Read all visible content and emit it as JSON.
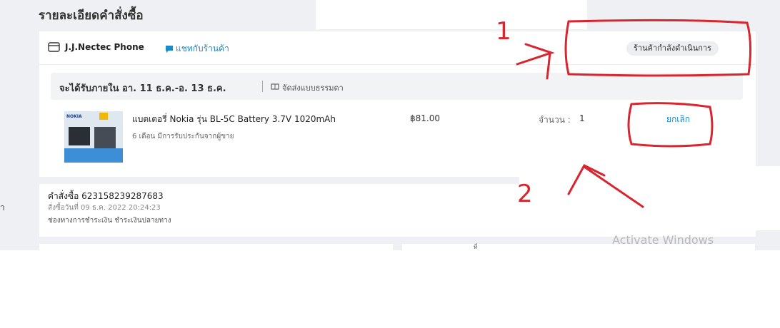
{
  "page": {
    "title": "รายละเอียดคำสั่งซื้อ",
    "side_char": "ำ"
  },
  "shop": {
    "name": "J.J.Nectec Phone",
    "chat_label": "แชทกับร้านค้า",
    "status": "ร้านค้ากำลังดำเนินการ"
  },
  "delivery": {
    "estimate": "จะได้รับภายใน อา. 11 ธ.ค.-อ. 13 ธ.ค.",
    "method": "จัดส่งแบบธรรมดา"
  },
  "product": {
    "thumb_logo": "NOKIA",
    "name": "แบตเตอรี่ Nokia รุ่น BL-5C Battery 3.7V 1020mAh",
    "warranty": "6 เดือน มีการรับประกันจากผู้ขาย",
    "price": "฿81.00",
    "qty_label": "จำนวน :",
    "qty_value": "1",
    "cancel_label": "ยกเลิก"
  },
  "order": {
    "number": "คำสั่งซื้อ 623158239287683",
    "date": "สั่งซื้อวันที่ 09 ธ.ค. 2022 20:24:23",
    "payment": "ช่องทางการชำระเงิน ชำระเงินปลายทาง"
  },
  "mini_card_right_text": "ที่",
  "annotations": {
    "label_1": "1",
    "label_2": "2",
    "color": "#d9252f"
  },
  "watermark": "Activate Windows"
}
